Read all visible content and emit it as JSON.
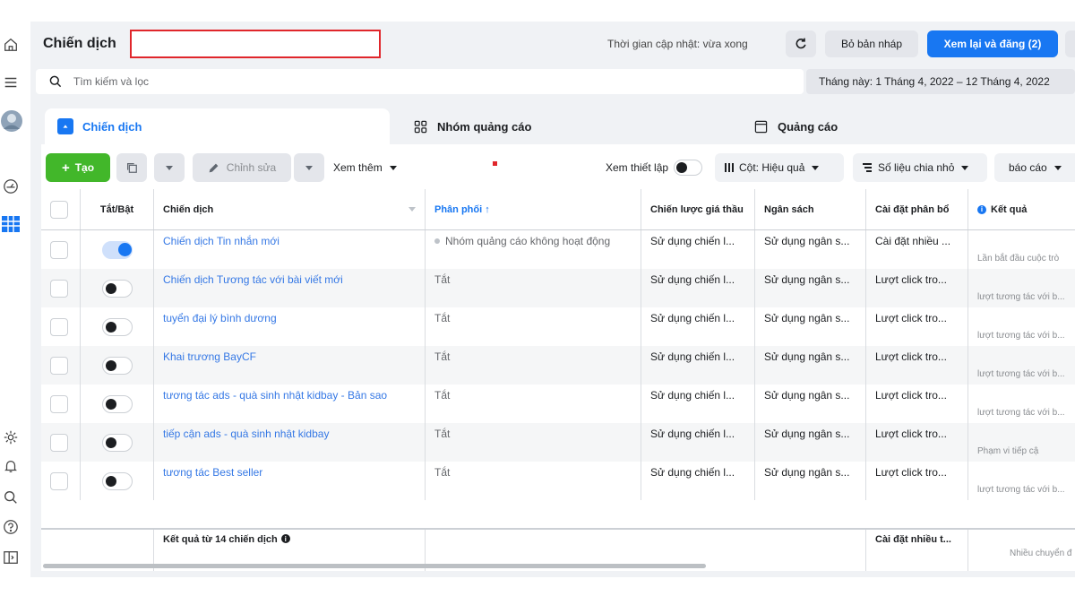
{
  "rail": {
    "icons": [
      "home-icon",
      "menu-icon",
      "avatar",
      "gauge-icon",
      "table-grid-icon",
      "settings-icon",
      "bell-icon",
      "search-icon",
      "help-icon",
      "panel-toggle-icon"
    ]
  },
  "header": {
    "title": "Chiến dịch",
    "update_time": "Thời gian cập nhật: vừa xong",
    "discard_label": "Bỏ bản nháp",
    "review_label": "Xem lại và đăng (2)"
  },
  "search": {
    "placeholder": "Tìm kiếm và lọc",
    "date_range": "Tháng này: 1 Tháng 4, 2022 – 12 Tháng 4, 2022"
  },
  "tabs": [
    {
      "label": "Chiến dịch"
    },
    {
      "label": "Nhóm quảng cáo"
    },
    {
      "label": "Quảng cáo"
    }
  ],
  "actions": {
    "create_label": "Tạo",
    "edit_label": "Chỉnh sửa",
    "more_label": "Xem thêm",
    "view_setup_label": "Xem thiết lập",
    "columns_label": "Cột: Hiệu quả",
    "breakdown_label": "Số liệu chia nhỏ",
    "report_label": "báo cáo"
  },
  "table": {
    "headers": {
      "toggle": "Tắt/Bật",
      "campaign": "Chiến dịch",
      "delivery": "Phân phối ↑",
      "bid_strategy": "Chiến lược giá thầu",
      "budget": "Ngân sách",
      "attribution": "Cài đặt phân bổ",
      "results": "Kết quả"
    },
    "rows": [
      {
        "on": true,
        "name": "Chiến dịch Tin nhắn mới",
        "delivery": "Nhóm quảng cáo không hoạt động",
        "bid": "Sử dụng chiến l...",
        "budget": "Sử dụng ngân s...",
        "attribution": "Cài đặt nhiều ...",
        "result": "Lần bắt đầu cuộc trò"
      },
      {
        "on": false,
        "name": "Chiến dịch Tương tác với bài viết mới",
        "delivery": "Tắt",
        "bid": "Sử dụng chiến l...",
        "budget": "Sử dụng ngân s...",
        "attribution": "Lượt click tro...",
        "result": "lượt tương tác với b..."
      },
      {
        "on": false,
        "name": "tuyển đại lý bình dương",
        "delivery": "Tắt",
        "bid": "Sử dụng chiến l...",
        "budget": "Sử dụng ngân s...",
        "attribution": "Lượt click tro...",
        "result": "lượt tương tác với b..."
      },
      {
        "on": false,
        "name": "Khai trương BayCF",
        "delivery": "Tắt",
        "bid": "Sử dụng chiến l...",
        "budget": "Sử dụng ngân s...",
        "attribution": "Lượt click tro...",
        "result": "lượt tương tác với b..."
      },
      {
        "on": false,
        "name": "tương tác ads - quà sinh nhật kidbay - Bản sao",
        "delivery": "Tắt",
        "bid": "Sử dụng chiến l...",
        "budget": "Sử dụng ngân s...",
        "attribution": "Lượt click tro...",
        "result": "lượt tương tác với b..."
      },
      {
        "on": false,
        "name": "tiếp cận ads - quà sinh nhật kidbay",
        "delivery": "Tắt",
        "bid": "Sử dụng chiến l...",
        "budget": "Sử dụng ngân s...",
        "attribution": "Lượt click tro...",
        "result": "Phạm vi tiếp cậ"
      },
      {
        "on": false,
        "name": "tương tác Best seller",
        "delivery": "Tắt",
        "bid": "Sử dụng chiến l...",
        "budget": "Sử dụng ngân s...",
        "attribution": "Lượt click tro...",
        "result": "lượt tương tác với b..."
      }
    ],
    "footer": {
      "summary": "Kết quả từ 14 chiến dịch",
      "attribution": "Cài đặt nhiều t...",
      "result": "Nhiều chuyển đ"
    }
  },
  "colors": {
    "accent": "#1877f2",
    "create": "#42b72a",
    "highlight": "#e0262b",
    "background": "#f0f2f5"
  }
}
